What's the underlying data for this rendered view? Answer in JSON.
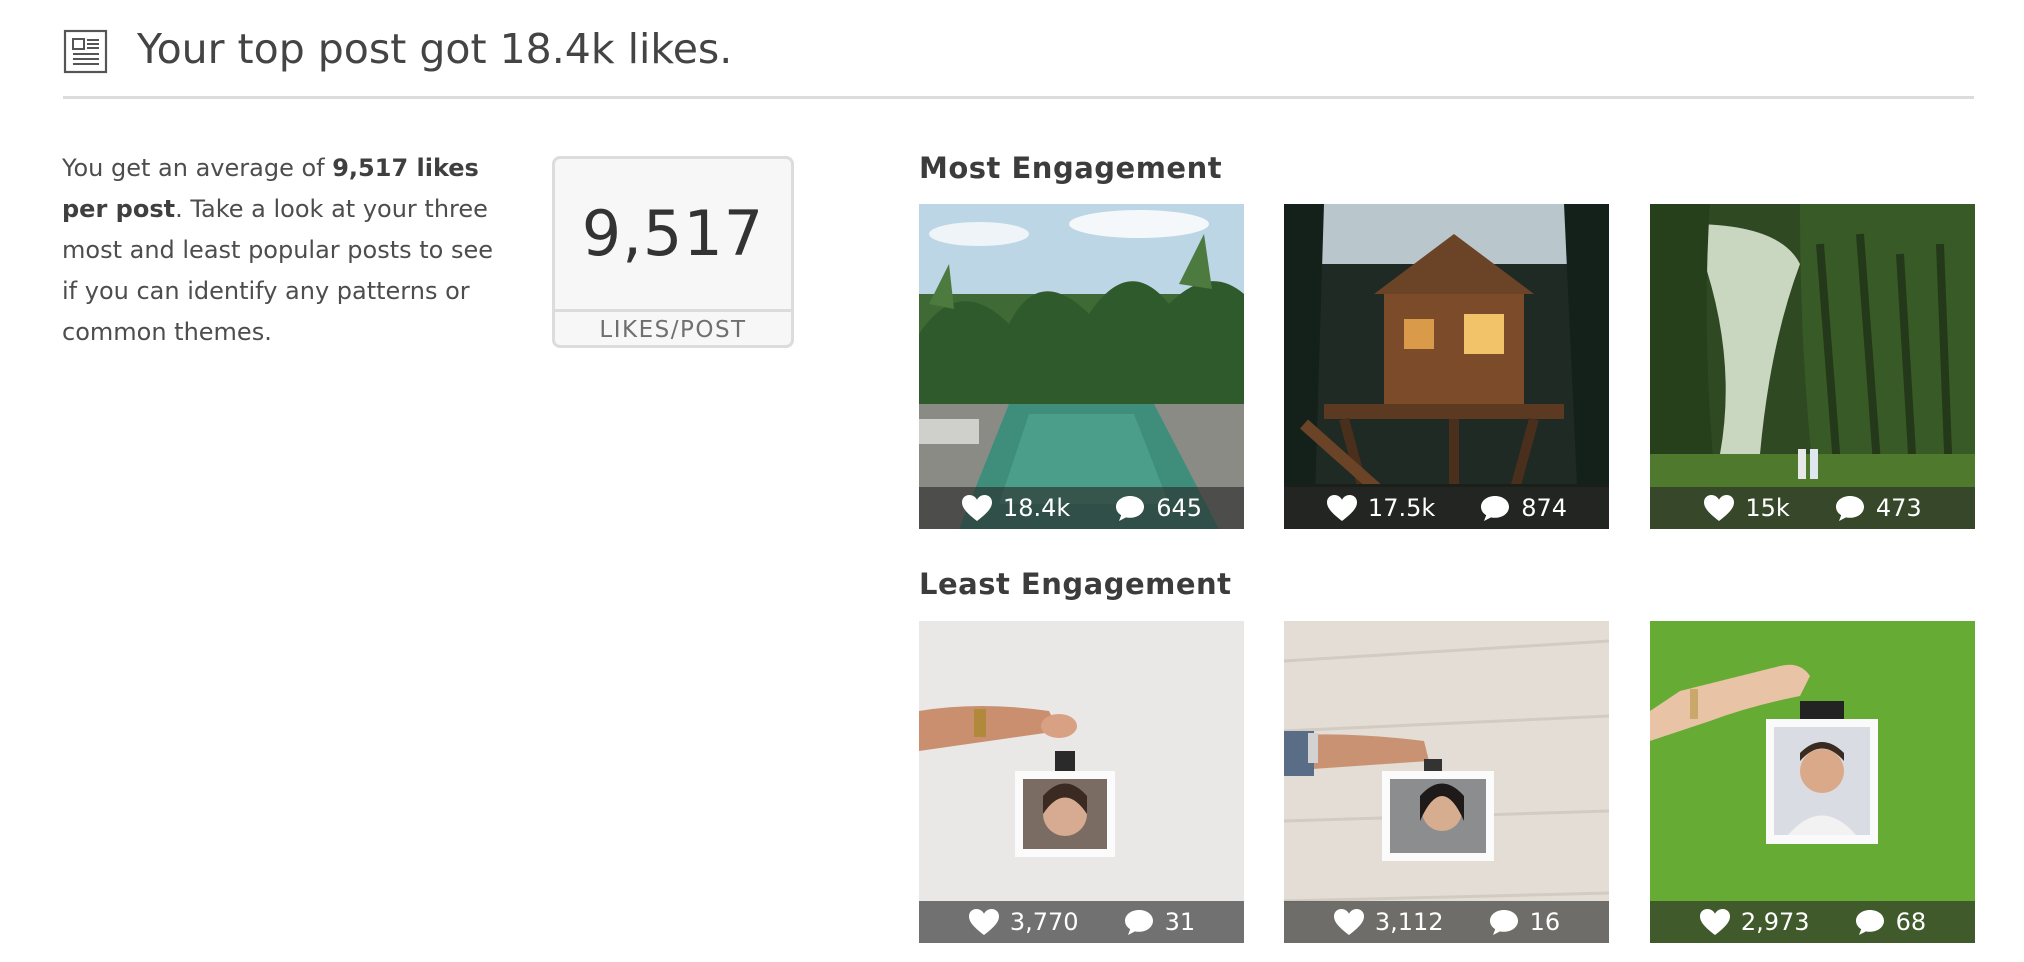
{
  "header": {
    "icon": "newspaper-icon",
    "title": "Your top post got 18.4k likes."
  },
  "summary": {
    "prefix": "You get an average of ",
    "highlight": "9,517 likes per post",
    "suffix": ". Take a look at your three most and least popular posts to see if you can identify any patterns or common themes."
  },
  "stat": {
    "value": "9,517",
    "label": "LIKES/POST"
  },
  "most_engagement": {
    "title": "Most Engagement",
    "posts": [
      {
        "scene": "tropical pool surrounded by palm trees",
        "likes": "18.4k",
        "comments": "645"
      },
      {
        "scene": "lit treehouse in forest at dusk",
        "likes": "17.5k",
        "comments": "874"
      },
      {
        "scene": "moss covered forest with two people",
        "likes": "15k",
        "comments": "473"
      }
    ]
  },
  "least_engagement": {
    "title": "Least Engagement",
    "posts": [
      {
        "scene": "hand holding clipped photo of woman on white wall",
        "likes": "3,770",
        "comments": "31"
      },
      {
        "scene": "hand holding clipped photo of woman on wood",
        "likes": "3,112",
        "comments": "16"
      },
      {
        "scene": "hand holding clipped photo of man on green",
        "likes": "2,973",
        "comments": "68"
      }
    ]
  },
  "icons": {
    "likes": "heart-icon",
    "comments": "comment-bubble-icon"
  },
  "colors": {
    "text": "#4a4a4a",
    "divider": "#dcdcdc",
    "stat_bg": "#f7f7f7",
    "overlay": "#282828"
  }
}
